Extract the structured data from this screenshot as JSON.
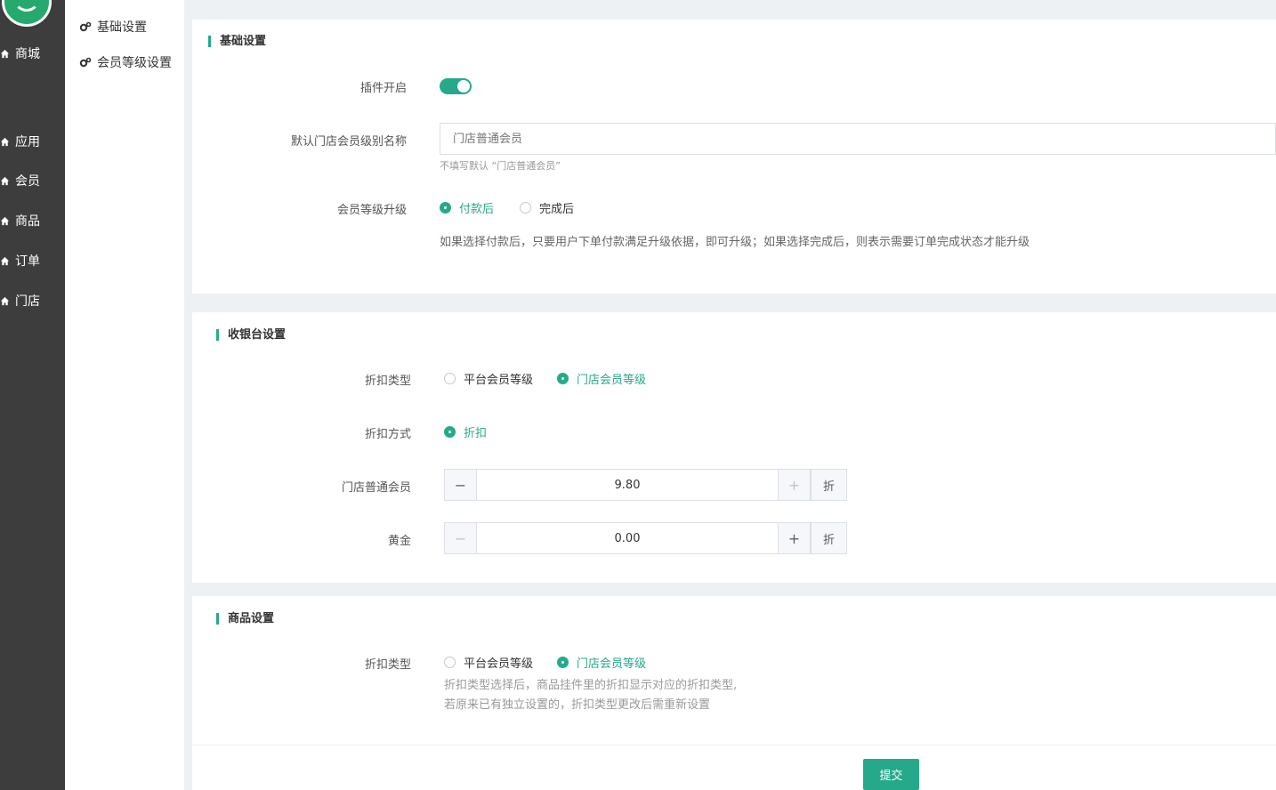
{
  "sidebar": {
    "items": [
      {
        "label": "商城"
      },
      {
        "label": "应用"
      },
      {
        "label": "会员"
      },
      {
        "label": "商品"
      },
      {
        "label": "订单"
      },
      {
        "label": "门店"
      }
    ]
  },
  "subnav": {
    "items": [
      {
        "label": "基础设置"
      },
      {
        "label": "会员等级设置"
      }
    ]
  },
  "basic": {
    "title": "基础设置",
    "plugin_label": "插件开启",
    "plugin_enabled": true,
    "default_name_label": "默认门店会员级别名称",
    "default_name_placeholder": "门店普通会员",
    "default_name_hint": "不填写默认 “门店普通会员”",
    "upgrade_label": "会员等级升级",
    "upgrade_options": [
      "付款后",
      "完成后"
    ],
    "upgrade_selected": "付款后",
    "upgrade_desc": "如果选择付款后，只要用户下单付款满足升级依据，即可升级；如果选择完成后，则表示需要订单完成状态才能升级"
  },
  "cashier": {
    "title": "收银台设置",
    "discount_type_label": "折扣类型",
    "discount_type_options": [
      "平台会员等级",
      "门店会员等级"
    ],
    "discount_type_selected": "门店会员等级",
    "discount_method_label": "折扣方式",
    "discount_method_option": "折扣",
    "levels": [
      {
        "name": "门店普通会员",
        "value": "9.80",
        "unit": "折"
      },
      {
        "name": "黄金",
        "value": "0.00",
        "unit": "折"
      }
    ],
    "minus_symbol": "−",
    "plus_symbol": "+"
  },
  "goods": {
    "title": "商品设置",
    "discount_type_label": "折扣类型",
    "discount_type_options": [
      "平台会员等级",
      "门店会员等级"
    ],
    "discount_type_selected": "门店会员等级",
    "desc_line1": "折扣类型选择后，商品挂件里的折扣显示对应的折扣类型,",
    "desc_line2": "若原来已有独立设置的，折扣类型更改后需重新设置"
  },
  "submit_label": "提交",
  "colors": {
    "accent": "#26a98b",
    "sidebar": "#3d3d3d"
  }
}
